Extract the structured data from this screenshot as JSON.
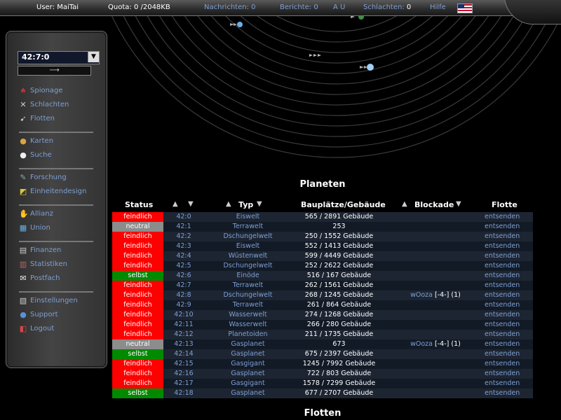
{
  "topbar": {
    "user_label": "User:",
    "user_value": "MaiTai",
    "quota_label": "Quota:",
    "quota_value": "0 /2048KB",
    "messages": "Nachrichten: 0",
    "reports": "Berichte: 0",
    "au": "A U",
    "battles_label": "Schlachten:",
    "battles_value": "0",
    "help": "Hilfe",
    "flag_icon": "us-flag-icon"
  },
  "sidebar": {
    "coord_value": "42:7:0",
    "go_arrow": "⟶",
    "items": [
      {
        "label": "Spionage",
        "icon": "spy-icon",
        "glyph": "♠"
      },
      {
        "label": "Schlachten",
        "icon": "swords-icon",
        "glyph": "✕"
      },
      {
        "label": "Flotten",
        "icon": "fleet-icon",
        "glyph": "➹"
      },
      {
        "label": "Karten",
        "icon": "map-icon",
        "glyph": "●"
      },
      {
        "label": "Suche",
        "icon": "search-icon",
        "glyph": "●"
      },
      {
        "label": "Forschung",
        "icon": "research-icon",
        "glyph": "✎"
      },
      {
        "label": "Einheitendesign",
        "icon": "design-icon",
        "glyph": "◩"
      },
      {
        "label": "Allianz",
        "icon": "alliance-icon",
        "glyph": "✋"
      },
      {
        "label": "Union",
        "icon": "union-icon",
        "glyph": "▦"
      },
      {
        "label": "Finanzen",
        "icon": "finance-icon",
        "glyph": "▤"
      },
      {
        "label": "Statistiken",
        "icon": "statistics-icon",
        "glyph": "▥"
      },
      {
        "label": "Postfach",
        "icon": "mail-icon",
        "glyph": "✉"
      },
      {
        "label": "Einstellungen",
        "icon": "settings-icon",
        "glyph": "▧"
      },
      {
        "label": "Support",
        "icon": "support-icon",
        "glyph": "●"
      },
      {
        "label": "Logout",
        "icon": "logout-icon",
        "glyph": "◧"
      }
    ]
  },
  "planets": {
    "title": "Planeten",
    "headers": {
      "status": "Status",
      "type": "Typ",
      "buildings": "Bauplätze/Gebäude",
      "blockade": "Blockade",
      "fleet": "Flotte"
    },
    "status_colors": {
      "feindlich": "#ff0000",
      "neutral": "#8c8c8c",
      "selbst": "#008a00"
    },
    "rows": [
      {
        "status": "feindlich",
        "coord": "42:0",
        "type": "Eiswelt",
        "build": "565 / 2891 Gebäude",
        "block_name": "",
        "block_tag": "",
        "block_num": "",
        "fleet": "entsenden"
      },
      {
        "status": "neutral",
        "coord": "42:1",
        "type": "Terrawelt",
        "build": "253",
        "block_name": "",
        "block_tag": "",
        "block_num": "",
        "fleet": "entsenden"
      },
      {
        "status": "feindlich",
        "coord": "42:2",
        "type": "Dschungelwelt",
        "build": "250 / 1552 Gebäude",
        "block_name": "",
        "block_tag": "",
        "block_num": "",
        "fleet": "entsenden"
      },
      {
        "status": "feindlich",
        "coord": "42:3",
        "type": "Eiswelt",
        "build": "552 / 1413 Gebäude",
        "block_name": "",
        "block_tag": "",
        "block_num": "",
        "fleet": "entsenden"
      },
      {
        "status": "feindlich",
        "coord": "42:4",
        "type": "Wüstenwelt",
        "build": "599 / 4449 Gebäude",
        "block_name": "",
        "block_tag": "",
        "block_num": "",
        "fleet": "entsenden"
      },
      {
        "status": "feindlich",
        "coord": "42:5",
        "type": "Dschungelwelt",
        "build": "252 / 2622 Gebäude",
        "block_name": "",
        "block_tag": "",
        "block_num": "",
        "fleet": "entsenden"
      },
      {
        "status": "selbst",
        "coord": "42:6",
        "type": "Einöde",
        "build": "516 / 167 Gebäude",
        "block_name": "",
        "block_tag": "",
        "block_num": "",
        "fleet": "entsenden"
      },
      {
        "status": "feindlich",
        "coord": "42:7",
        "type": "Terrawelt",
        "build": "262 / 1561 Gebäude",
        "block_name": "",
        "block_tag": "",
        "block_num": "",
        "fleet": "entsenden"
      },
      {
        "status": "feindlich",
        "coord": "42:8",
        "type": "Dschungelwelt",
        "build": "268 / 1245 Gebäude",
        "block_name": "wOoza",
        "block_tag": "[-4-]",
        "block_num": "(1)",
        "fleet": "entsenden"
      },
      {
        "status": "feindlich",
        "coord": "42:9",
        "type": "Terrawelt",
        "build": "261 / 864 Gebäude",
        "block_name": "",
        "block_tag": "",
        "block_num": "",
        "fleet": "entsenden"
      },
      {
        "status": "feindlich",
        "coord": "42:10",
        "type": "Wasserwelt",
        "build": "274 / 1268 Gebäude",
        "block_name": "",
        "block_tag": "",
        "block_num": "",
        "fleet": "entsenden"
      },
      {
        "status": "feindlich",
        "coord": "42:11",
        "type": "Wasserwelt",
        "build": "266 / 280 Gebäude",
        "block_name": "",
        "block_tag": "",
        "block_num": "",
        "fleet": "entsenden"
      },
      {
        "status": "feindlich",
        "coord": "42:12",
        "type": "Planetoiden",
        "build": "211 / 1735 Gebäude",
        "block_name": "",
        "block_tag": "",
        "block_num": "",
        "fleet": "entsenden"
      },
      {
        "status": "neutral",
        "coord": "42:13",
        "type": "Gasplanet",
        "build": "673",
        "block_name": "wOoza",
        "block_tag": "[-4-]",
        "block_num": "(1)",
        "fleet": "entsenden"
      },
      {
        "status": "selbst",
        "coord": "42:14",
        "type": "Gasplanet",
        "build": "675 / 2397 Gebäude",
        "block_name": "",
        "block_tag": "",
        "block_num": "",
        "fleet": "entsenden"
      },
      {
        "status": "feindlich",
        "coord": "42:15",
        "type": "Gasgigant",
        "build": "1245 / 7992 Gebäude",
        "block_name": "",
        "block_tag": "",
        "block_num": "",
        "fleet": "entsenden"
      },
      {
        "status": "feindlich",
        "coord": "42:16",
        "type": "Gasplanet",
        "build": "722 / 803 Gebäude",
        "block_name": "",
        "block_tag": "",
        "block_num": "",
        "fleet": "entsenden"
      },
      {
        "status": "feindlich",
        "coord": "42:17",
        "type": "Gasgigant",
        "build": "1578 / 7299 Gebäude",
        "block_name": "",
        "block_tag": "",
        "block_num": "",
        "fleet": "entsenden"
      },
      {
        "status": "selbst",
        "coord": "42:18",
        "type": "Gasplanet",
        "build": "677 / 2707 Gebäude",
        "block_name": "",
        "block_tag": "",
        "block_num": "",
        "fleet": "entsenden"
      }
    ]
  },
  "fleets": {
    "title": "Flotten"
  }
}
